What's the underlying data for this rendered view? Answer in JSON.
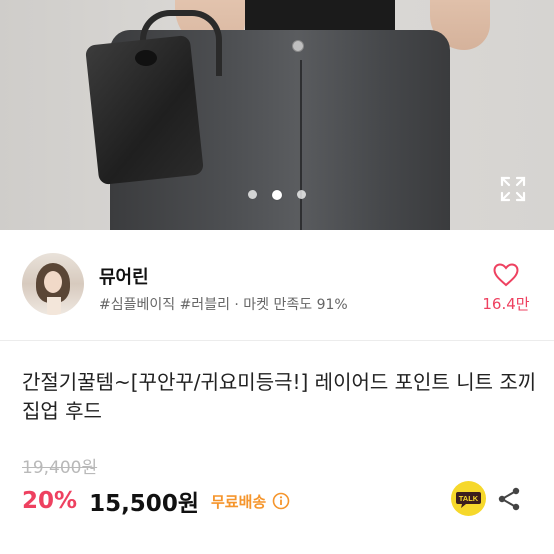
{
  "hero": {
    "carousel_total": 3,
    "carousel_active": 2,
    "expand_icon": "expand-icon"
  },
  "seller": {
    "name": "뮤어린",
    "tags": "#심플베이직 #러블리 · 마켓 만족도 91%",
    "like_count": "16.4만",
    "like_icon": "heart-outline-icon"
  },
  "product": {
    "title": "간절기꿀템~[꾸안꾸/귀요미등극!] 레이어드 포인트 니트 조끼 집업 후드",
    "original_price": "19,400원",
    "discount": "20%",
    "price": "15,500원",
    "shipping": "무료배송"
  },
  "actions": {
    "talk_label": "TALK",
    "share_icon": "share-icon"
  },
  "colors": {
    "accent": "#ee4160",
    "shipping": "#f5952c",
    "talk_bg": "#f6d82b"
  }
}
